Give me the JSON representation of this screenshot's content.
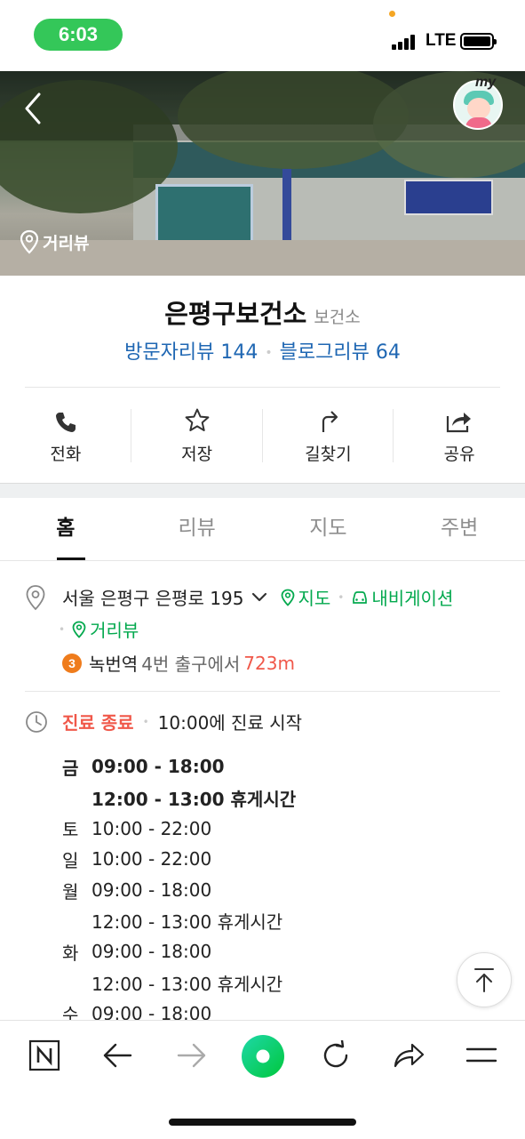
{
  "status_bar": {
    "time": "6:03",
    "network": "LTE"
  },
  "hero": {
    "street_view_label": "거리뷰",
    "my_label": "my"
  },
  "place": {
    "name": "은평구보건소",
    "category": "보건소",
    "visitor_reviews": "방문자리뷰 144",
    "blog_reviews": "블로그리뷰 64"
  },
  "actions": [
    {
      "label": "전화",
      "icon": "phone-icon"
    },
    {
      "label": "저장",
      "icon": "star-icon"
    },
    {
      "label": "길찾기",
      "icon": "directions-icon"
    },
    {
      "label": "공유",
      "icon": "share-icon"
    }
  ],
  "tabs": [
    {
      "label": "홈",
      "active": true
    },
    {
      "label": "리뷰",
      "active": false
    },
    {
      "label": "지도",
      "active": false
    },
    {
      "label": "주변",
      "active": false
    }
  ],
  "location": {
    "address": "서울 은평구 은평로 195",
    "map_link": "지도",
    "navigation_link": "내비게이션",
    "street_view_link": "거리뷰",
    "subway": {
      "line": "3",
      "station": "녹번역",
      "exit": "4번 출구에서",
      "distance": "723m"
    },
    "line_color": "#ef7c1c"
  },
  "hours": {
    "status": "진료 종료",
    "next_open": "10:00에 진료 시작",
    "rows": [
      {
        "day": "금",
        "text": "09:00 - 18:00",
        "bold": true
      },
      {
        "day": "",
        "text": "12:00 - 13:00 휴게시간",
        "bold": true
      },
      {
        "day": "토",
        "text": "10:00 - 22:00"
      },
      {
        "day": "일",
        "text": "10:00 - 22:00"
      },
      {
        "day": "월",
        "text": "09:00 - 18:00"
      },
      {
        "day": "",
        "text": "12:00 - 13:00 휴게시간"
      },
      {
        "day": "화",
        "text": "09:00 - 18:00"
      },
      {
        "day": "",
        "text": "12:00 - 13:00 휴게시간"
      },
      {
        "day": "수",
        "text": "09:00 - 18:00"
      }
    ]
  },
  "colors": {
    "link_blue": "#1f67b3",
    "green": "#03a94e",
    "closed_red": "#f0584a",
    "naver_green": "#1ed8a8"
  },
  "bottom_nav": [
    "naver-home-icon",
    "back-arrow-icon",
    "forward-arrow-icon",
    "green-home-button-icon",
    "refresh-icon",
    "share-arrow-icon",
    "menu-icon"
  ]
}
